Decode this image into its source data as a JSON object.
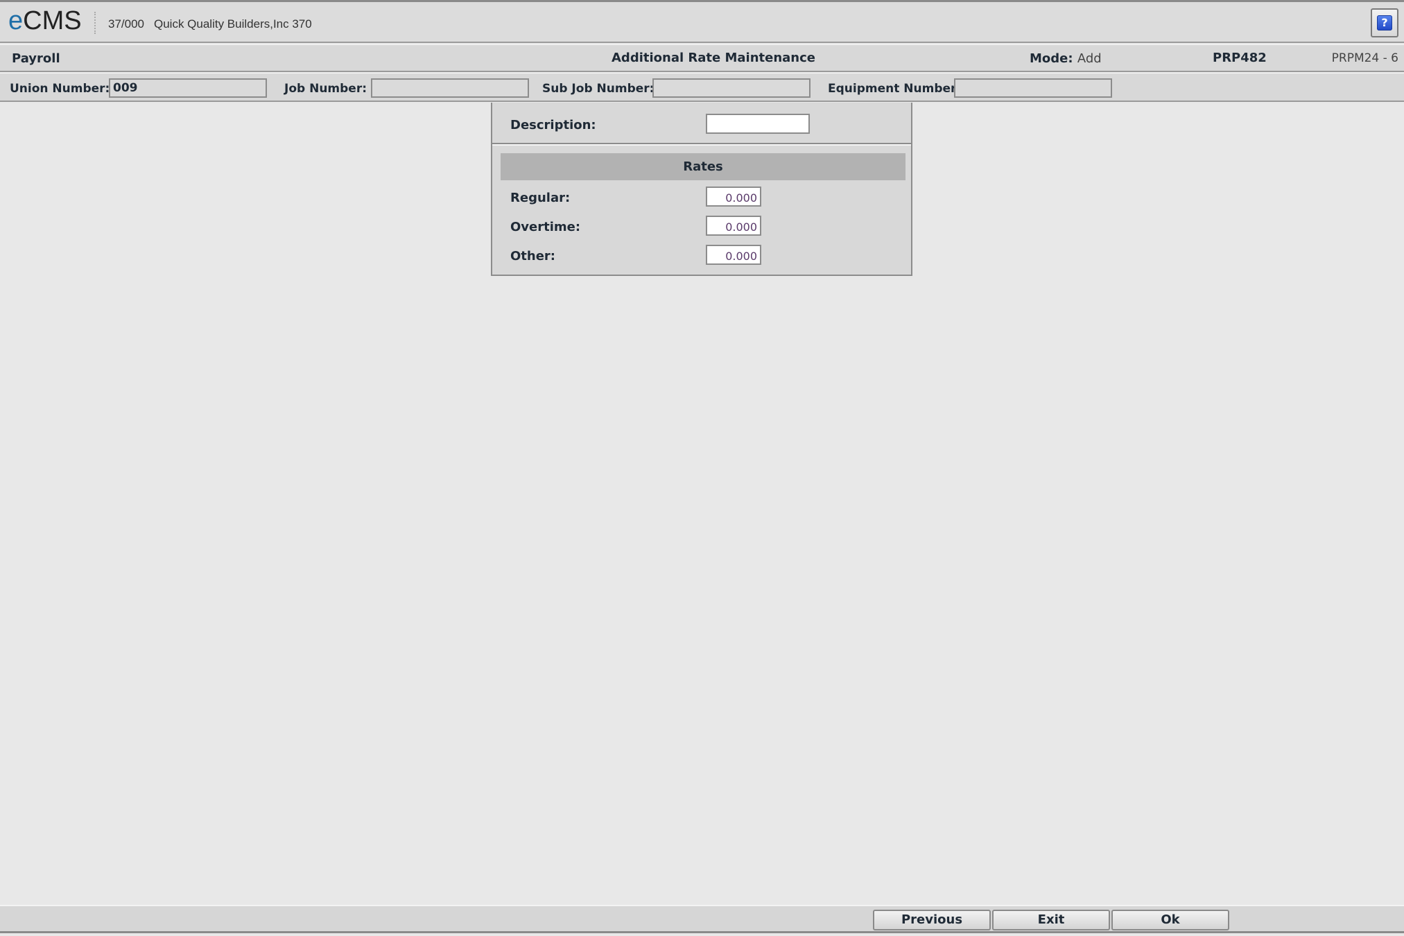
{
  "app": {
    "logo_prefix": "e",
    "logo_rest": "CMS",
    "company_code": "37/000",
    "company_name": "Quick Quality Builders,Inc 370",
    "help_label": "?"
  },
  "header": {
    "module": "Payroll",
    "title": "Additional Rate Maintenance",
    "mode_label": "Mode:",
    "mode_value": "Add",
    "program": "PRP482",
    "version": "PRPM24 - 6"
  },
  "keys": {
    "union_label": "Union Number:",
    "union_value": "009",
    "job_label": "Job Number:",
    "job_value": "",
    "subjob_label": "Sub Job Number:",
    "subjob_value": "",
    "equipment_label": "Equipment Number:",
    "equipment_value": ""
  },
  "form": {
    "description_label": "Description:",
    "description_value": "",
    "rates_header": "Rates",
    "rates": [
      {
        "label": "Regular:",
        "value": "0.000"
      },
      {
        "label": "Overtime:",
        "value": "0.000"
      },
      {
        "label": "Other:",
        "value": "0.000"
      }
    ]
  },
  "footer": {
    "previous_label": "Previous",
    "exit_label": "Exit",
    "ok_label": "Ok"
  }
}
